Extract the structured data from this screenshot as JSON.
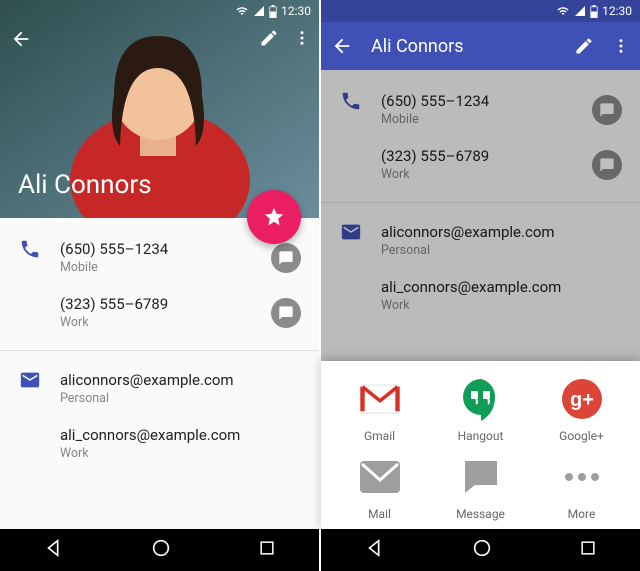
{
  "status": {
    "time": "12:30"
  },
  "contact": {
    "name": "Ali Connors"
  },
  "phones": [
    {
      "value": "(650) 555–1234",
      "label": "Mobile"
    },
    {
      "value": "(323) 555–6789",
      "label": "Work"
    }
  ],
  "emails": [
    {
      "value": "aliconnors@example.com",
      "label": "Personal"
    },
    {
      "value": "ali_connors@example.com",
      "label": "Work"
    }
  ],
  "share": {
    "row1": [
      {
        "name": "gmail",
        "label": "Gmail"
      },
      {
        "name": "hangout",
        "label": "Hangout"
      },
      {
        "name": "gplus",
        "label": "Google+"
      }
    ],
    "row2": [
      {
        "name": "mail",
        "label": "Mail"
      },
      {
        "name": "message",
        "label": "Message"
      },
      {
        "name": "more",
        "label": "More"
      }
    ]
  },
  "colors": {
    "primary": "#3f51b5",
    "accent": "#e91e63",
    "grey": "#8b8b8b"
  }
}
